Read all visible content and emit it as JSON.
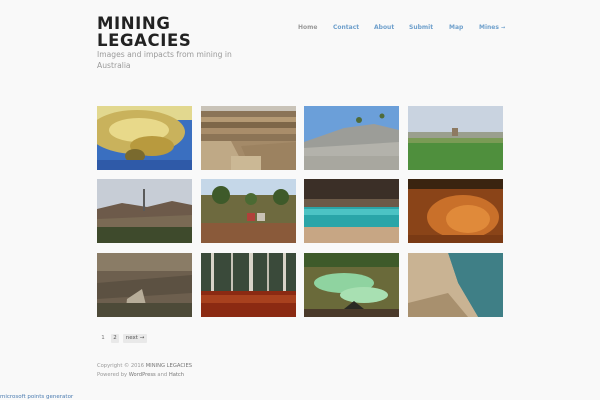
{
  "site": {
    "title": "MINING LEGACIES",
    "tagline": "Images and impacts from mining in Australia"
  },
  "nav": {
    "items": [
      {
        "label": "Home"
      },
      {
        "label": "Contact"
      },
      {
        "label": "About"
      },
      {
        "label": "Submit"
      },
      {
        "label": "Map"
      },
      {
        "label": "Mines"
      }
    ],
    "caret": "→"
  },
  "gallery": {
    "tiles": [
      {
        "subject": "yellow tailings in blue water"
      },
      {
        "subject": "terraced open pit"
      },
      {
        "subject": "grey waste rock heap"
      },
      {
        "subject": "green field with ruins"
      },
      {
        "subject": "hills with smelter stack"
      },
      {
        "subject": "sheds in bushland"
      },
      {
        "subject": "turquoise pit lake"
      },
      {
        "subject": "orange cracked sediment"
      },
      {
        "subject": "aerial cleared land"
      },
      {
        "subject": "dead trees in red water"
      },
      {
        "subject": "green acid drainage"
      },
      {
        "subject": "pit lake with bank"
      }
    ]
  },
  "pagination": {
    "current": "1",
    "page2": "2",
    "next": "next →"
  },
  "footer": {
    "copyright_prefix": "Copyright © 2016",
    "copyright_site": "MINING LEGACIES",
    "powered_prefix": "Powered by",
    "wordpress": "WordPress",
    "and": "and",
    "theme": "Hatch"
  },
  "bottom_link": "microsoft points generator",
  "colors": {
    "background": "#f9f9f9",
    "nav_link": "#6fa0cc",
    "nav_current": "#999999",
    "title": "#222222"
  }
}
